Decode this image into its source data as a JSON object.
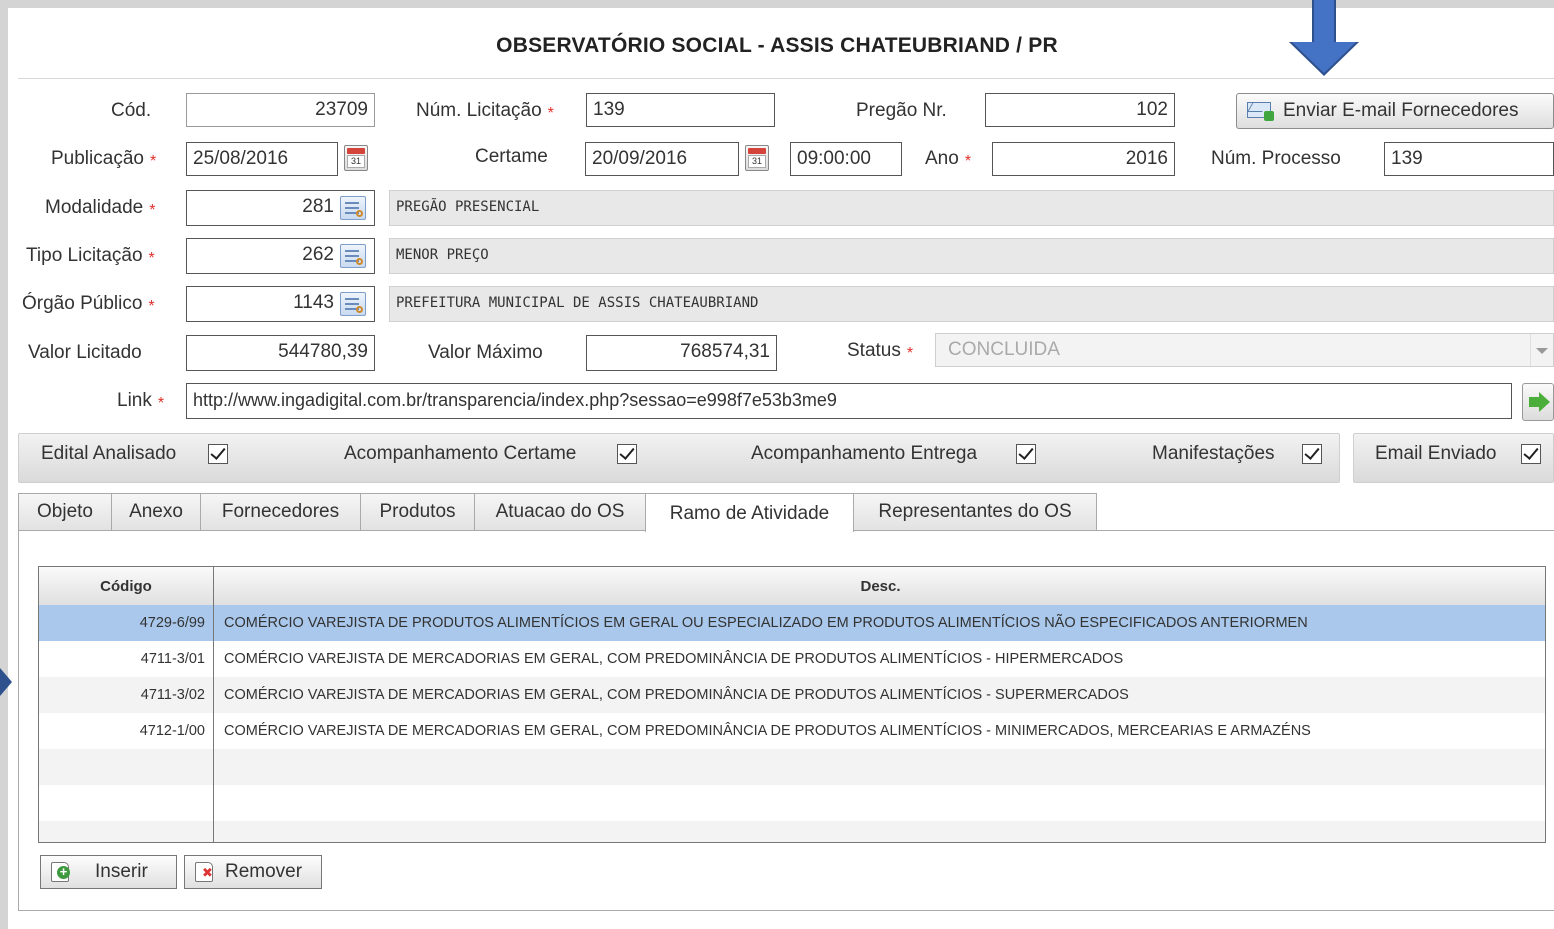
{
  "app": {
    "title": "OBSERVATÓRIO SOCIAL - ASSIS CHATEUBRIAND / PR"
  },
  "form": {
    "cod": {
      "label": "Cód.",
      "value": "23709"
    },
    "num_licitacao": {
      "label": "Núm. Licitação",
      "value": "139"
    },
    "pregao_nr": {
      "label": "Pregão Nr.",
      "value": "102"
    },
    "enviar_email_label": "Enviar E-mail Fornecedores",
    "publicacao": {
      "label": "Publicação",
      "value": "25/08/2016"
    },
    "certame": {
      "label": "Certame",
      "date": "20/09/2016",
      "time": "09:00:00"
    },
    "ano": {
      "label": "Ano",
      "value": "2016"
    },
    "num_processo": {
      "label": "Núm. Processo",
      "value": "139"
    },
    "modalidade": {
      "label": "Modalidade",
      "code": "281",
      "desc": "PREGÃO PRESENCIAL"
    },
    "tipo_licitacao": {
      "label": "Tipo Licitação",
      "code": "262",
      "desc": "MENOR PREÇO"
    },
    "orgao_publico": {
      "label": "Órgão Público",
      "code": "1143",
      "desc": "PREFEITURA MUNICIPAL DE ASSIS CHATEAUBRIAND"
    },
    "valor_licitado": {
      "label": "Valor Licitado",
      "value": "544780,39"
    },
    "valor_maximo": {
      "label": "Valor Máximo",
      "value": "768574,31"
    },
    "status": {
      "label": "Status",
      "value": "CONCLUIDA"
    },
    "link": {
      "label": "Link",
      "value": "http://www.ingadigital.com.br/transparencia/index.php?sessao=e998f7e53b3me9"
    },
    "required_marker": "*",
    "calendar_day": "31"
  },
  "checks": {
    "edital_analisado": "Edital Analisado",
    "acompanhamento_certame": "Acompanhamento Certame",
    "acompanhamento_entrega": "Acompanhamento Entrega",
    "manifestacoes": "Manifestações",
    "email_enviado": "Email Enviado"
  },
  "tabs": [
    "Objeto",
    "Anexo",
    "Fornecedores",
    "Produtos",
    "Atuacao do OS",
    "Ramo de Atividade",
    "Representantes do OS"
  ],
  "active_tab": "Ramo de Atividade",
  "grid": {
    "headers": {
      "codigo": "Código",
      "desc": "Desc."
    },
    "rows": [
      {
        "codigo": "4729-6/99",
        "desc": "COMÉRCIO VAREJISTA DE PRODUTOS ALIMENTÍCIOS EM GERAL OU ESPECIALIZADO EM PRODUTOS ALIMENTÍCIOS NÃO ESPECIFICADOS ANTERIORMEN"
      },
      {
        "codigo": "4711-3/01",
        "desc": "COMÉRCIO VAREJISTA DE MERCADORIAS EM GERAL, COM PREDOMINÂNCIA DE PRODUTOS ALIMENTÍCIOS - HIPERMERCADOS"
      },
      {
        "codigo": "4711-3/02",
        "desc": "COMÉRCIO VAREJISTA DE MERCADORIAS EM GERAL, COM PREDOMINÂNCIA DE PRODUTOS ALIMENTÍCIOS - SUPERMERCADOS"
      },
      {
        "codigo": "4712-1/00",
        "desc": "COMÉRCIO VAREJISTA DE MERCADORIAS EM GERAL, COM PREDOMINÂNCIA DE PRODUTOS ALIMENTÍCIOS - MINIMERCADOS, MERCEARIAS E ARMAZÉNS"
      }
    ]
  },
  "buttons": {
    "inserir": "Inserir",
    "remover": "Remover"
  },
  "colors": {
    "selected_row": "#a9c8ec",
    "annotation_arrow": "#4472c4",
    "required": "#e0302a"
  }
}
